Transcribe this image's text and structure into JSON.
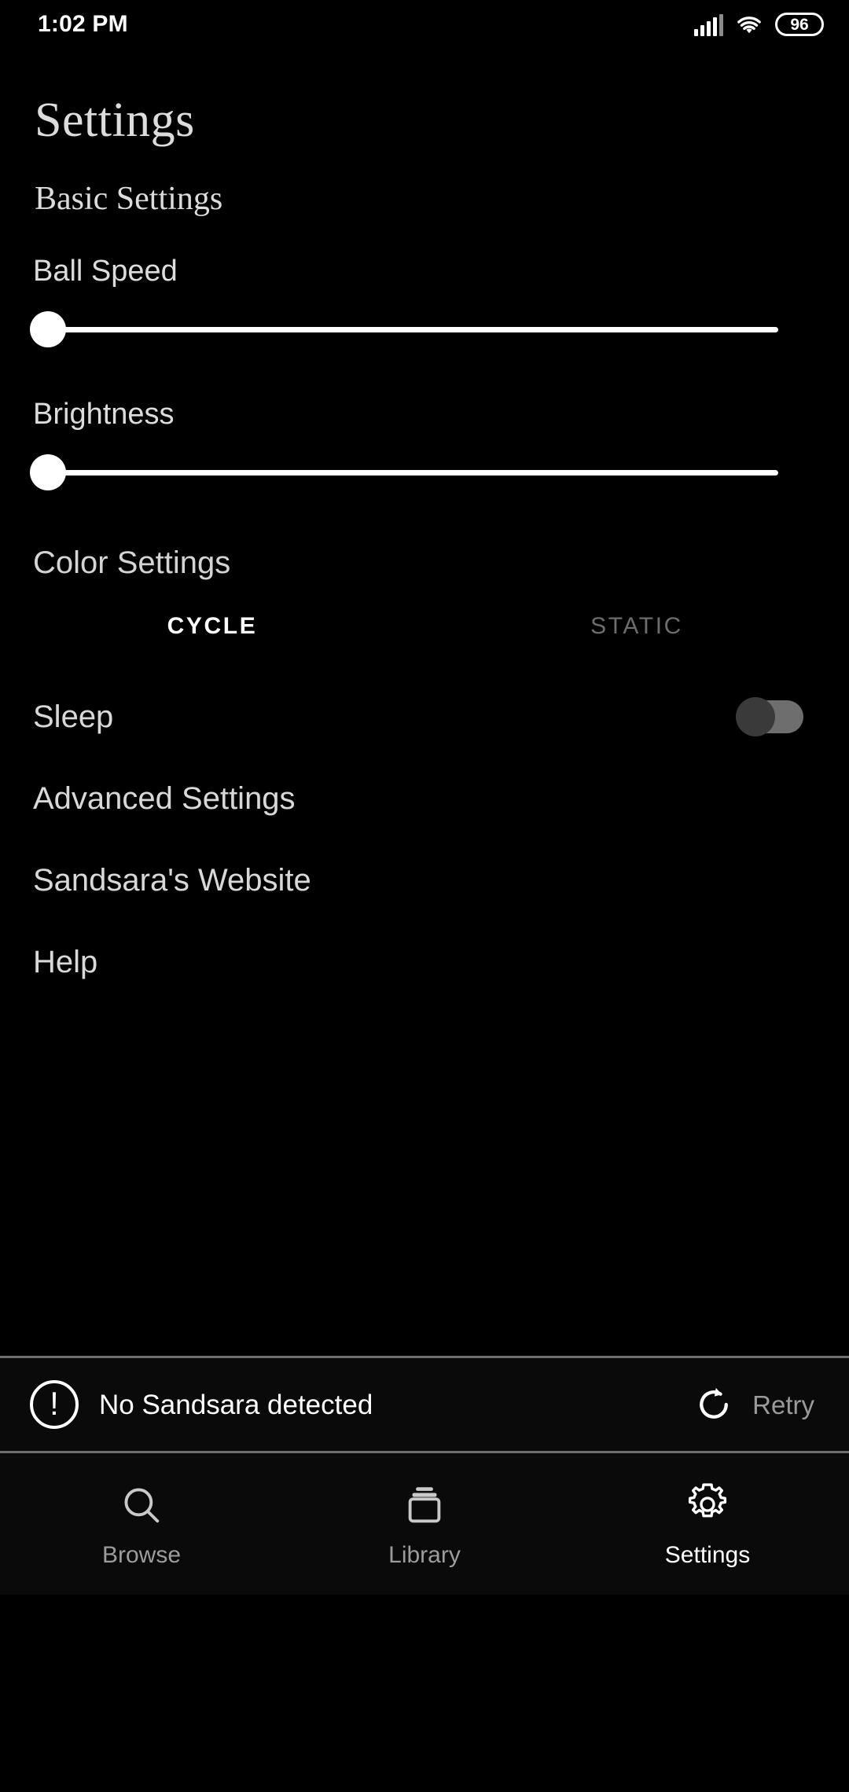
{
  "statusbar": {
    "time": "1:02 PM",
    "battery_percent": "96",
    "signal_icon": "cellular-signal-icon",
    "wifi_icon": "wifi-icon",
    "battery_icon": "battery-icon"
  },
  "header": {
    "title": "Settings"
  },
  "basic_settings": {
    "heading": "Basic Settings",
    "sliders": [
      {
        "label": "Ball Speed",
        "value": 0,
        "min": 0,
        "max": 100
      },
      {
        "label": "Brightness",
        "value": 0,
        "min": 0,
        "max": 100
      }
    ]
  },
  "color_settings": {
    "heading": "Color Settings",
    "tabs": [
      {
        "label": "CYCLE",
        "active": true
      },
      {
        "label": "STATIC",
        "active": false
      }
    ]
  },
  "sleep": {
    "label": "Sleep",
    "toggle_state": "off"
  },
  "menu": {
    "items": [
      {
        "label": "Advanced Settings"
      },
      {
        "label": "Sandsara's Website"
      },
      {
        "label": "Help"
      }
    ]
  },
  "device_status": {
    "alert_icon": "exclamation-circle-icon",
    "message": "No Sandsara detected",
    "retry_icon": "refresh-icon",
    "retry_label": "Retry"
  },
  "bottom_nav": {
    "items": [
      {
        "label": "Browse",
        "icon": "search-icon",
        "active": false
      },
      {
        "label": "Library",
        "icon": "library-stack-icon",
        "active": false
      },
      {
        "label": "Settings",
        "icon": "gear-icon",
        "active": true
      }
    ]
  },
  "colors": {
    "background": "#000000",
    "text_primary": "#d8d8d8",
    "text_muted": "#6d6d6d",
    "accent": "#ffffff",
    "divider": "#6f6f6f"
  }
}
